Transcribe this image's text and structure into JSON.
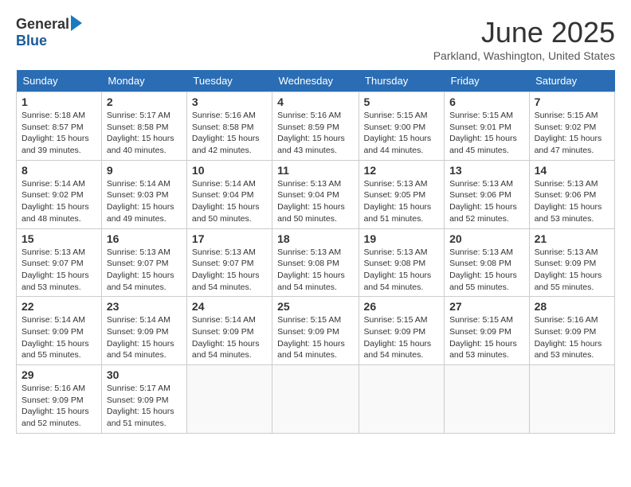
{
  "logo": {
    "general": "General",
    "blue": "Blue"
  },
  "title": "June 2025",
  "location": "Parkland, Washington, United States",
  "weekdays": [
    "Sunday",
    "Monday",
    "Tuesday",
    "Wednesday",
    "Thursday",
    "Friday",
    "Saturday"
  ],
  "weeks": [
    [
      {
        "day": "1",
        "sunrise": "5:18 AM",
        "sunset": "8:57 PM",
        "daylight": "15 hours and 39 minutes."
      },
      {
        "day": "2",
        "sunrise": "5:17 AM",
        "sunset": "8:58 PM",
        "daylight": "15 hours and 40 minutes."
      },
      {
        "day": "3",
        "sunrise": "5:16 AM",
        "sunset": "8:58 PM",
        "daylight": "15 hours and 42 minutes."
      },
      {
        "day": "4",
        "sunrise": "5:16 AM",
        "sunset": "8:59 PM",
        "daylight": "15 hours and 43 minutes."
      },
      {
        "day": "5",
        "sunrise": "5:15 AM",
        "sunset": "9:00 PM",
        "daylight": "15 hours and 44 minutes."
      },
      {
        "day": "6",
        "sunrise": "5:15 AM",
        "sunset": "9:01 PM",
        "daylight": "15 hours and 45 minutes."
      },
      {
        "day": "7",
        "sunrise": "5:15 AM",
        "sunset": "9:02 PM",
        "daylight": "15 hours and 47 minutes."
      }
    ],
    [
      {
        "day": "8",
        "sunrise": "5:14 AM",
        "sunset": "9:02 PM",
        "daylight": "15 hours and 48 minutes."
      },
      {
        "day": "9",
        "sunrise": "5:14 AM",
        "sunset": "9:03 PM",
        "daylight": "15 hours and 49 minutes."
      },
      {
        "day": "10",
        "sunrise": "5:14 AM",
        "sunset": "9:04 PM",
        "daylight": "15 hours and 50 minutes."
      },
      {
        "day": "11",
        "sunrise": "5:13 AM",
        "sunset": "9:04 PM",
        "daylight": "15 hours and 50 minutes."
      },
      {
        "day": "12",
        "sunrise": "5:13 AM",
        "sunset": "9:05 PM",
        "daylight": "15 hours and 51 minutes."
      },
      {
        "day": "13",
        "sunrise": "5:13 AM",
        "sunset": "9:06 PM",
        "daylight": "15 hours and 52 minutes."
      },
      {
        "day": "14",
        "sunrise": "5:13 AM",
        "sunset": "9:06 PM",
        "daylight": "15 hours and 53 minutes."
      }
    ],
    [
      {
        "day": "15",
        "sunrise": "5:13 AM",
        "sunset": "9:07 PM",
        "daylight": "15 hours and 53 minutes."
      },
      {
        "day": "16",
        "sunrise": "5:13 AM",
        "sunset": "9:07 PM",
        "daylight": "15 hours and 54 minutes."
      },
      {
        "day": "17",
        "sunrise": "5:13 AM",
        "sunset": "9:07 PM",
        "daylight": "15 hours and 54 minutes."
      },
      {
        "day": "18",
        "sunrise": "5:13 AM",
        "sunset": "9:08 PM",
        "daylight": "15 hours and 54 minutes."
      },
      {
        "day": "19",
        "sunrise": "5:13 AM",
        "sunset": "9:08 PM",
        "daylight": "15 hours and 54 minutes."
      },
      {
        "day": "20",
        "sunrise": "5:13 AM",
        "sunset": "9:08 PM",
        "daylight": "15 hours and 55 minutes."
      },
      {
        "day": "21",
        "sunrise": "5:13 AM",
        "sunset": "9:09 PM",
        "daylight": "15 hours and 55 minutes."
      }
    ],
    [
      {
        "day": "22",
        "sunrise": "5:14 AM",
        "sunset": "9:09 PM",
        "daylight": "15 hours and 55 minutes."
      },
      {
        "day": "23",
        "sunrise": "5:14 AM",
        "sunset": "9:09 PM",
        "daylight": "15 hours and 54 minutes."
      },
      {
        "day": "24",
        "sunrise": "5:14 AM",
        "sunset": "9:09 PM",
        "daylight": "15 hours and 54 minutes."
      },
      {
        "day": "25",
        "sunrise": "5:15 AM",
        "sunset": "9:09 PM",
        "daylight": "15 hours and 54 minutes."
      },
      {
        "day": "26",
        "sunrise": "5:15 AM",
        "sunset": "9:09 PM",
        "daylight": "15 hours and 54 minutes."
      },
      {
        "day": "27",
        "sunrise": "5:15 AM",
        "sunset": "9:09 PM",
        "daylight": "15 hours and 53 minutes."
      },
      {
        "day": "28",
        "sunrise": "5:16 AM",
        "sunset": "9:09 PM",
        "daylight": "15 hours and 53 minutes."
      }
    ],
    [
      {
        "day": "29",
        "sunrise": "5:16 AM",
        "sunset": "9:09 PM",
        "daylight": "15 hours and 52 minutes."
      },
      {
        "day": "30",
        "sunrise": "5:17 AM",
        "sunset": "9:09 PM",
        "daylight": "15 hours and 51 minutes."
      },
      null,
      null,
      null,
      null,
      null
    ]
  ]
}
